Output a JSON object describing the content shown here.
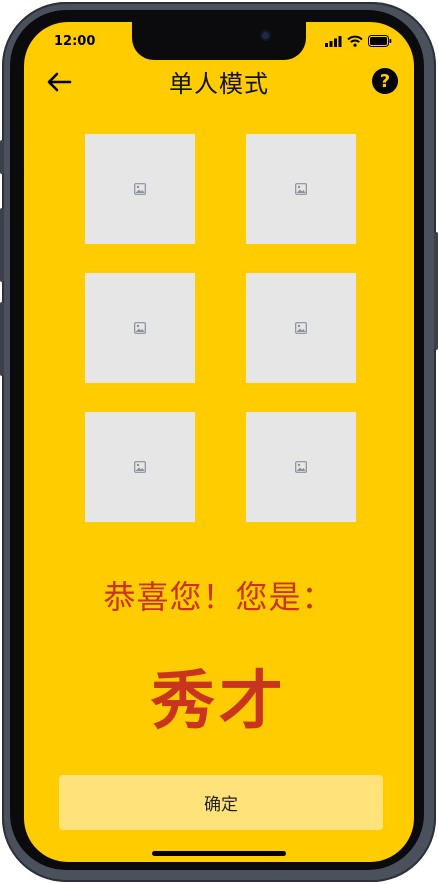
{
  "status_bar": {
    "time": "12:00"
  },
  "nav": {
    "title": "单人模式",
    "help_label": "?"
  },
  "tiles": [
    {
      "icon": "image-placeholder-icon"
    },
    {
      "icon": "image-placeholder-icon"
    },
    {
      "icon": "image-placeholder-icon"
    },
    {
      "icon": "image-placeholder-icon"
    },
    {
      "icon": "image-placeholder-icon"
    },
    {
      "icon": "image-placeholder-icon"
    }
  ],
  "result": {
    "message": "恭喜您！您是：",
    "rank": "秀才"
  },
  "footer": {
    "confirm_label": "确定"
  },
  "colors": {
    "background": "#FFCC00",
    "accent_text": "#C8341E",
    "button": "#FFE37A",
    "tile": "#E6E6E6"
  }
}
